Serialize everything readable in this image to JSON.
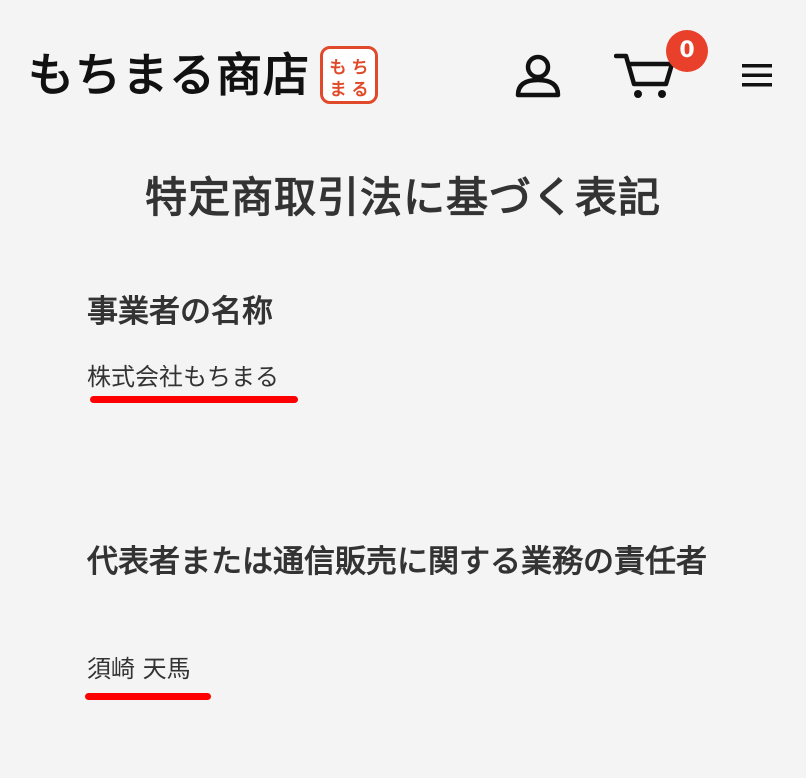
{
  "header": {
    "logo_text": "もちまる商店",
    "logo_mark_text": "もちまる",
    "cart_count": "0"
  },
  "page": {
    "title": "特定商取引法に基づく表記"
  },
  "sections": [
    {
      "heading": "事業者の名称",
      "value": "株式会社もちまる"
    },
    {
      "heading": "代表者または通信販売に関する業務の責任者",
      "value": "須崎 天馬"
    }
  ],
  "colors": {
    "accent": "#e8402a",
    "highlight_underline": "#ff0000",
    "background": "#f4f4f4",
    "text": "#333333"
  },
  "icons": {
    "user": "user-icon",
    "cart": "cart-icon",
    "menu": "hamburger-menu-icon"
  }
}
